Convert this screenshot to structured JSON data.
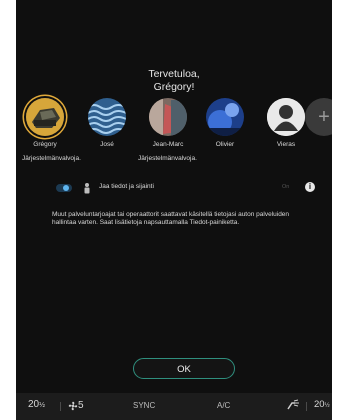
{
  "welcome": {
    "line1": "Tervetuloa,",
    "line2": "Grégory!"
  },
  "profiles": [
    {
      "name": "Grégory",
      "role": "Järjestelmänvalvoja.",
      "selected": true,
      "icon": "car-trunk-avatar"
    },
    {
      "name": "José",
      "role": "",
      "selected": false,
      "icon": "wave-pattern-avatar"
    },
    {
      "name": "Jean-Marc",
      "role": "Järjestelmänvalvoja.",
      "selected": false,
      "icon": "photo-avatar"
    },
    {
      "name": "Olivier",
      "role": "",
      "selected": false,
      "icon": "blue-photo-avatar"
    },
    {
      "name": "Vieras",
      "role": "",
      "selected": false,
      "icon": "guest-person-avatar"
    }
  ],
  "add_profile": {
    "symbol": "+"
  },
  "share": {
    "label": "Jaa tiedot ja sijainti",
    "state": "On",
    "info_symbol": "i"
  },
  "disclaimer": "Muut palveluntarjoajat tai operaattorit saattavat käsitellä tietojasi auton palveluiden hallintaa varten. Saat lisätietoja napsauttamalla Tiedot-painiketta.",
  "ok_button": {
    "label": "OK"
  },
  "bottom_bar": {
    "temp_left": "20",
    "temp_left_unit": "½",
    "fan_level": "5",
    "sync": "SYNC",
    "ac": "A/C",
    "temp_right": "20",
    "temp_right_unit": "½"
  },
  "colors": {
    "accent": "#2f8f7e",
    "selected_ring": "#e0a93a",
    "toggle_on": "#5fb6f0",
    "background": "#0f0f0f"
  }
}
